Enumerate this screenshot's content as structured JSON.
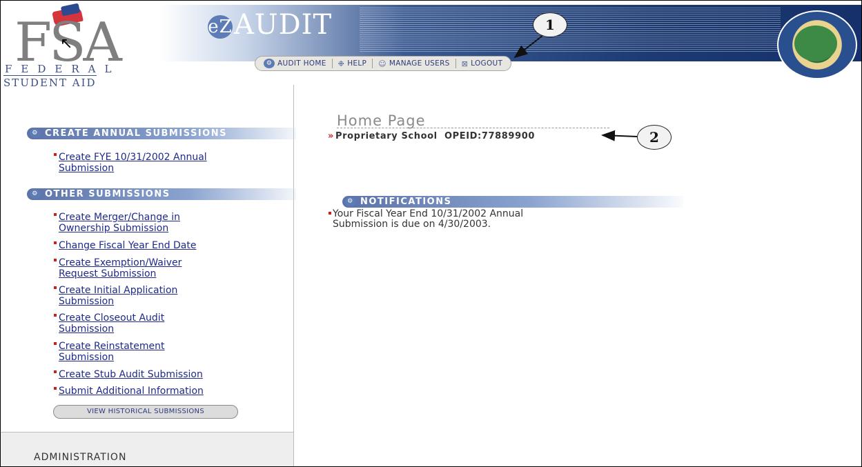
{
  "header": {
    "logo_main": "FSA",
    "logo_line1": "FEDERAL",
    "logo_line2": "STUDENT AID",
    "app_name": "AUDIT",
    "app_prefix": "eZ",
    "nav": [
      {
        "label": "AUDIT HOME",
        "icon": "ez-icon"
      },
      {
        "label": "HELP",
        "icon": "lifebuoy-icon"
      },
      {
        "label": "MANAGE USERS",
        "icon": "users-icon"
      },
      {
        "label": "LOGOUT",
        "icon": "close-box-icon"
      }
    ],
    "seal_icon": "department-of-education-seal"
  },
  "sidebar": {
    "annual_header": "CREATE ANNUAL SUBMISSIONS",
    "annual_links": [
      "Create FYE 10/31/2002 Annual",
      "Submission"
    ],
    "other_header": "OTHER SUBMISSIONS",
    "other_links": [
      [
        "Create Merger/Change in",
        "Ownership Submission"
      ],
      [
        "Change Fiscal Year End Date"
      ],
      [
        "Create Exemption/Waiver",
        "Request Submission"
      ],
      [
        "Create Initial Application",
        "Submission"
      ],
      [
        "Create Closeout Audit",
        "Submission"
      ],
      [
        "Create Reinstatement",
        "Submission"
      ],
      [
        "Create Stub Audit Submission"
      ],
      [
        "Submit Additional Information"
      ]
    ],
    "history_button": "VIEW HISTORICAL SUBMISSIONS",
    "admin_label": "ADMINISTRATION"
  },
  "main": {
    "title": "Home Page",
    "school_marker": "»",
    "school_name": "Proprietary School",
    "opeid": "OPEID:77889900",
    "notifications_header": "NOTIFICATIONS",
    "notification_line1": "Your Fiscal Year End 10/31/2002 Annual",
    "notification_line2": "Submission is due on 4/30/2003."
  },
  "callouts": [
    "1",
    "2"
  ],
  "colors": {
    "link": "#1f2a8a",
    "bullet": "#cc1e1e",
    "header_blue": "#1d3a72",
    "section_bar": "#5a72a8"
  }
}
